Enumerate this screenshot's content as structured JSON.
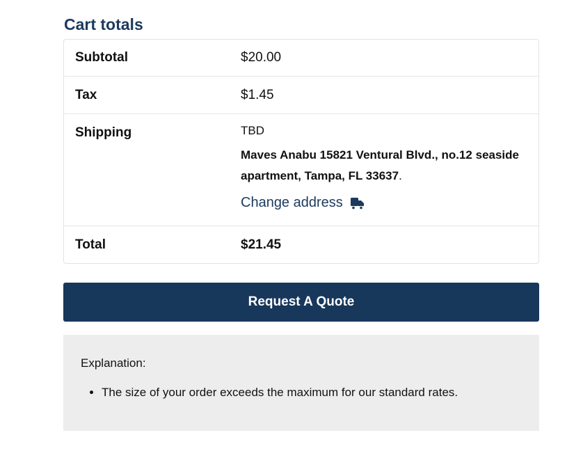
{
  "cart_totals": {
    "title": "Cart totals",
    "subtotal_label": "Subtotal",
    "subtotal_value": "$20.00",
    "tax_label": "Tax",
    "tax_value": "$1.45",
    "shipping_label": "Shipping",
    "shipping_method": "TBD",
    "shipping_address": "Maves Anabu 15821 Ventural Blvd., no.12 seaside apartment, Tampa, FL 33637",
    "shipping_address_period": ".",
    "change_address_label": "Change address",
    "change_address_icon": "truck-icon",
    "total_label": "Total",
    "total_value": "$21.45"
  },
  "actions": {
    "request_quote_label": "Request A Quote"
  },
  "explanation": {
    "title": "Explanation:",
    "items": [
      "The size of your order exceeds the maximum for our standard rates."
    ]
  },
  "colors": {
    "accent": "#1c3a5e",
    "button_bg": "#17375b",
    "panel_bg": "#ededed"
  }
}
